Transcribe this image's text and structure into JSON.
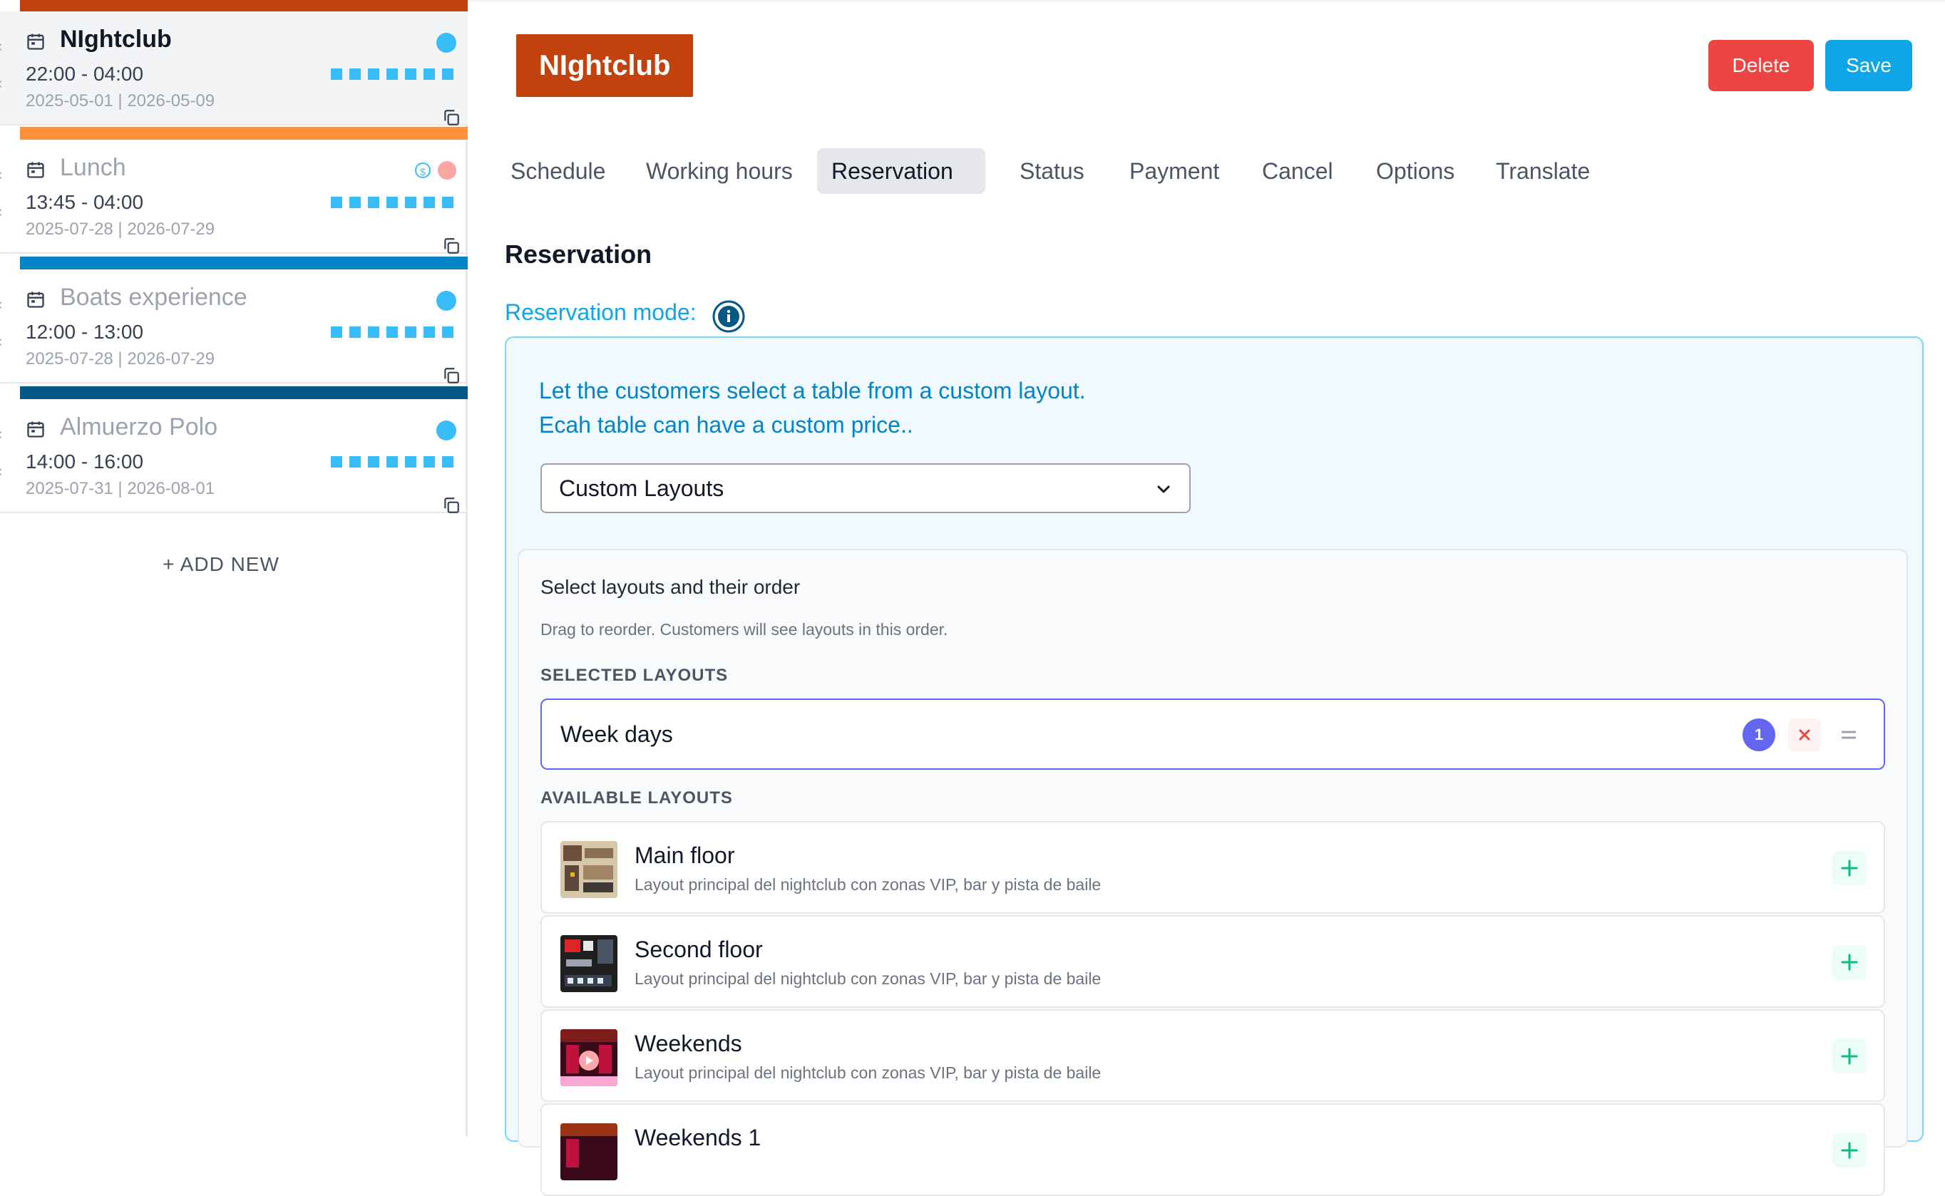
{
  "sidebar": {
    "cards": [
      {
        "title": "NIghtclub",
        "time": "22:00 - 04:00",
        "dates": "2025-05-01 | 2026-05-09",
        "bar_color": "#c2410c",
        "active": true
      },
      {
        "title": "Lunch",
        "time": "13:45 - 04:00",
        "dates": "2025-07-28 | 2026-07-29",
        "bar_color": "#fb923c",
        "active": false
      },
      {
        "title": "Boats experience",
        "time": "12:00 - 13:00",
        "dates": "2025-07-28 | 2026-07-29",
        "bar_color": "#0284c7",
        "active": false
      },
      {
        "title": "Almuerzo Polo",
        "time": "14:00 - 16:00",
        "dates": "2025-07-31 | 2026-08-01",
        "bar_color": "#075985",
        "active": false
      }
    ],
    "add_new": "+ ADD NEW"
  },
  "header": {
    "title": "NIghtclub",
    "delete_label": "Delete",
    "save_label": "Save"
  },
  "tabs": [
    {
      "label": "Schedule",
      "active": false
    },
    {
      "label": "Working hours",
      "active": false
    },
    {
      "label": "Reservation",
      "active": true
    },
    {
      "label": "Status",
      "active": false
    },
    {
      "label": "Payment",
      "active": false
    },
    {
      "label": "Cancel",
      "active": false
    },
    {
      "label": "Options",
      "active": false
    },
    {
      "label": "Translate",
      "active": false
    }
  ],
  "reservation": {
    "section_title": "Reservation",
    "mode_label": "Reservation mode:",
    "description_line1": "Let the customers select a table from a custom layout.",
    "description_line2": "Ecah table can have a custom price..",
    "mode_select": "Custom Layouts",
    "layouts": {
      "heading": "Select layouts and their order",
      "hint": "Drag to reorder. Customers will see layouts in this order.",
      "selected_label": "SELECTED LAYOUTS",
      "available_label": "AVAILABLE LAYOUTS",
      "selected": [
        {
          "name": "Week days",
          "order": "1"
        }
      ],
      "available": [
        {
          "name": "Main floor",
          "description": "Layout principal del nightclub con zonas VIP, bar y pista de baile"
        },
        {
          "name": "Second floor",
          "description": "Layout principal del nightclub con zonas VIP, bar y pista de baile"
        },
        {
          "name": "Weekends",
          "description": "Layout principal del nightclub con zonas VIP, bar y pista de baile"
        },
        {
          "name": "Weekends 1",
          "description": ""
        }
      ]
    }
  },
  "colors": {
    "accent": "#0ea5e9",
    "danger": "#ef4444",
    "brand": "#c2410c",
    "indigo": "#6366f1"
  }
}
